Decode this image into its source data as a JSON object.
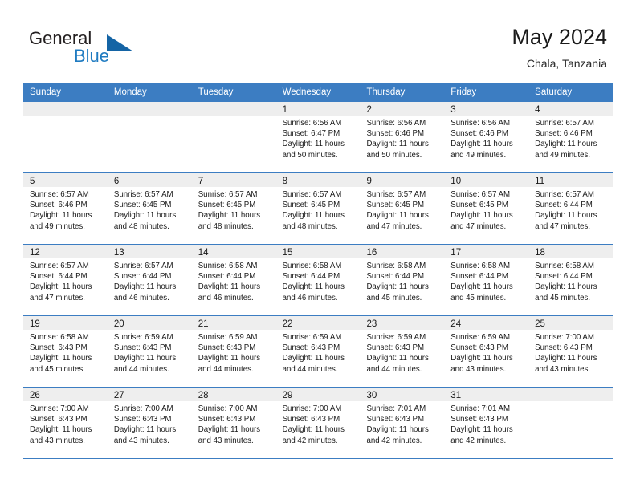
{
  "brand": {
    "name_part1": "General",
    "name_part2": "Blue",
    "triangle_icon": "triangle-logo-icon",
    "accent_color": "#1464a5",
    "blue_color": "#1f7bc1"
  },
  "header": {
    "title": "May 2024",
    "subtitle": "Chala, Tanzania"
  },
  "calendar": {
    "header_bg": "#3c7dc2",
    "day_band_bg": "#eeeeee",
    "weekdays": [
      "Sunday",
      "Monday",
      "Tuesday",
      "Wednesday",
      "Thursday",
      "Friday",
      "Saturday"
    ],
    "weeks": [
      [
        {
          "empty": true,
          "day": "",
          "sunrise": "",
          "sunset": "",
          "daylight_line1": "",
          "daylight_line2": ""
        },
        {
          "empty": true,
          "day": "",
          "sunrise": "",
          "sunset": "",
          "daylight_line1": "",
          "daylight_line2": ""
        },
        {
          "empty": true,
          "day": "",
          "sunrise": "",
          "sunset": "",
          "daylight_line1": "",
          "daylight_line2": ""
        },
        {
          "empty": false,
          "day": "1",
          "sunrise": "Sunrise: 6:56 AM",
          "sunset": "Sunset: 6:47 PM",
          "daylight_line1": "Daylight: 11 hours",
          "daylight_line2": "and 50 minutes."
        },
        {
          "empty": false,
          "day": "2",
          "sunrise": "Sunrise: 6:56 AM",
          "sunset": "Sunset: 6:46 PM",
          "daylight_line1": "Daylight: 11 hours",
          "daylight_line2": "and 50 minutes."
        },
        {
          "empty": false,
          "day": "3",
          "sunrise": "Sunrise: 6:56 AM",
          "sunset": "Sunset: 6:46 PM",
          "daylight_line1": "Daylight: 11 hours",
          "daylight_line2": "and 49 minutes."
        },
        {
          "empty": false,
          "day": "4",
          "sunrise": "Sunrise: 6:57 AM",
          "sunset": "Sunset: 6:46 PM",
          "daylight_line1": "Daylight: 11 hours",
          "daylight_line2": "and 49 minutes."
        }
      ],
      [
        {
          "empty": false,
          "day": "5",
          "sunrise": "Sunrise: 6:57 AM",
          "sunset": "Sunset: 6:46 PM",
          "daylight_line1": "Daylight: 11 hours",
          "daylight_line2": "and 49 minutes."
        },
        {
          "empty": false,
          "day": "6",
          "sunrise": "Sunrise: 6:57 AM",
          "sunset": "Sunset: 6:45 PM",
          "daylight_line1": "Daylight: 11 hours",
          "daylight_line2": "and 48 minutes."
        },
        {
          "empty": false,
          "day": "7",
          "sunrise": "Sunrise: 6:57 AM",
          "sunset": "Sunset: 6:45 PM",
          "daylight_line1": "Daylight: 11 hours",
          "daylight_line2": "and 48 minutes."
        },
        {
          "empty": false,
          "day": "8",
          "sunrise": "Sunrise: 6:57 AM",
          "sunset": "Sunset: 6:45 PM",
          "daylight_line1": "Daylight: 11 hours",
          "daylight_line2": "and 48 minutes."
        },
        {
          "empty": false,
          "day": "9",
          "sunrise": "Sunrise: 6:57 AM",
          "sunset": "Sunset: 6:45 PM",
          "daylight_line1": "Daylight: 11 hours",
          "daylight_line2": "and 47 minutes."
        },
        {
          "empty": false,
          "day": "10",
          "sunrise": "Sunrise: 6:57 AM",
          "sunset": "Sunset: 6:45 PM",
          "daylight_line1": "Daylight: 11 hours",
          "daylight_line2": "and 47 minutes."
        },
        {
          "empty": false,
          "day": "11",
          "sunrise": "Sunrise: 6:57 AM",
          "sunset": "Sunset: 6:44 PM",
          "daylight_line1": "Daylight: 11 hours",
          "daylight_line2": "and 47 minutes."
        }
      ],
      [
        {
          "empty": false,
          "day": "12",
          "sunrise": "Sunrise: 6:57 AM",
          "sunset": "Sunset: 6:44 PM",
          "daylight_line1": "Daylight: 11 hours",
          "daylight_line2": "and 47 minutes."
        },
        {
          "empty": false,
          "day": "13",
          "sunrise": "Sunrise: 6:57 AM",
          "sunset": "Sunset: 6:44 PM",
          "daylight_line1": "Daylight: 11 hours",
          "daylight_line2": "and 46 minutes."
        },
        {
          "empty": false,
          "day": "14",
          "sunrise": "Sunrise: 6:58 AM",
          "sunset": "Sunset: 6:44 PM",
          "daylight_line1": "Daylight: 11 hours",
          "daylight_line2": "and 46 minutes."
        },
        {
          "empty": false,
          "day": "15",
          "sunrise": "Sunrise: 6:58 AM",
          "sunset": "Sunset: 6:44 PM",
          "daylight_line1": "Daylight: 11 hours",
          "daylight_line2": "and 46 minutes."
        },
        {
          "empty": false,
          "day": "16",
          "sunrise": "Sunrise: 6:58 AM",
          "sunset": "Sunset: 6:44 PM",
          "daylight_line1": "Daylight: 11 hours",
          "daylight_line2": "and 45 minutes."
        },
        {
          "empty": false,
          "day": "17",
          "sunrise": "Sunrise: 6:58 AM",
          "sunset": "Sunset: 6:44 PM",
          "daylight_line1": "Daylight: 11 hours",
          "daylight_line2": "and 45 minutes."
        },
        {
          "empty": false,
          "day": "18",
          "sunrise": "Sunrise: 6:58 AM",
          "sunset": "Sunset: 6:44 PM",
          "daylight_line1": "Daylight: 11 hours",
          "daylight_line2": "and 45 minutes."
        }
      ],
      [
        {
          "empty": false,
          "day": "19",
          "sunrise": "Sunrise: 6:58 AM",
          "sunset": "Sunset: 6:43 PM",
          "daylight_line1": "Daylight: 11 hours",
          "daylight_line2": "and 45 minutes."
        },
        {
          "empty": false,
          "day": "20",
          "sunrise": "Sunrise: 6:59 AM",
          "sunset": "Sunset: 6:43 PM",
          "daylight_line1": "Daylight: 11 hours",
          "daylight_line2": "and 44 minutes."
        },
        {
          "empty": false,
          "day": "21",
          "sunrise": "Sunrise: 6:59 AM",
          "sunset": "Sunset: 6:43 PM",
          "daylight_line1": "Daylight: 11 hours",
          "daylight_line2": "and 44 minutes."
        },
        {
          "empty": false,
          "day": "22",
          "sunrise": "Sunrise: 6:59 AM",
          "sunset": "Sunset: 6:43 PM",
          "daylight_line1": "Daylight: 11 hours",
          "daylight_line2": "and 44 minutes."
        },
        {
          "empty": false,
          "day": "23",
          "sunrise": "Sunrise: 6:59 AM",
          "sunset": "Sunset: 6:43 PM",
          "daylight_line1": "Daylight: 11 hours",
          "daylight_line2": "and 44 minutes."
        },
        {
          "empty": false,
          "day": "24",
          "sunrise": "Sunrise: 6:59 AM",
          "sunset": "Sunset: 6:43 PM",
          "daylight_line1": "Daylight: 11 hours",
          "daylight_line2": "and 43 minutes."
        },
        {
          "empty": false,
          "day": "25",
          "sunrise": "Sunrise: 7:00 AM",
          "sunset": "Sunset: 6:43 PM",
          "daylight_line1": "Daylight: 11 hours",
          "daylight_line2": "and 43 minutes."
        }
      ],
      [
        {
          "empty": false,
          "day": "26",
          "sunrise": "Sunrise: 7:00 AM",
          "sunset": "Sunset: 6:43 PM",
          "daylight_line1": "Daylight: 11 hours",
          "daylight_line2": "and 43 minutes."
        },
        {
          "empty": false,
          "day": "27",
          "sunrise": "Sunrise: 7:00 AM",
          "sunset": "Sunset: 6:43 PM",
          "daylight_line1": "Daylight: 11 hours",
          "daylight_line2": "and 43 minutes."
        },
        {
          "empty": false,
          "day": "28",
          "sunrise": "Sunrise: 7:00 AM",
          "sunset": "Sunset: 6:43 PM",
          "daylight_line1": "Daylight: 11 hours",
          "daylight_line2": "and 43 minutes."
        },
        {
          "empty": false,
          "day": "29",
          "sunrise": "Sunrise: 7:00 AM",
          "sunset": "Sunset: 6:43 PM",
          "daylight_line1": "Daylight: 11 hours",
          "daylight_line2": "and 42 minutes."
        },
        {
          "empty": false,
          "day": "30",
          "sunrise": "Sunrise: 7:01 AM",
          "sunset": "Sunset: 6:43 PM",
          "daylight_line1": "Daylight: 11 hours",
          "daylight_line2": "and 42 minutes."
        },
        {
          "empty": false,
          "day": "31",
          "sunrise": "Sunrise: 7:01 AM",
          "sunset": "Sunset: 6:43 PM",
          "daylight_line1": "Daylight: 11 hours",
          "daylight_line2": "and 42 minutes."
        },
        {
          "empty": true,
          "day": "",
          "sunrise": "",
          "sunset": "",
          "daylight_line1": "",
          "daylight_line2": ""
        }
      ]
    ]
  }
}
